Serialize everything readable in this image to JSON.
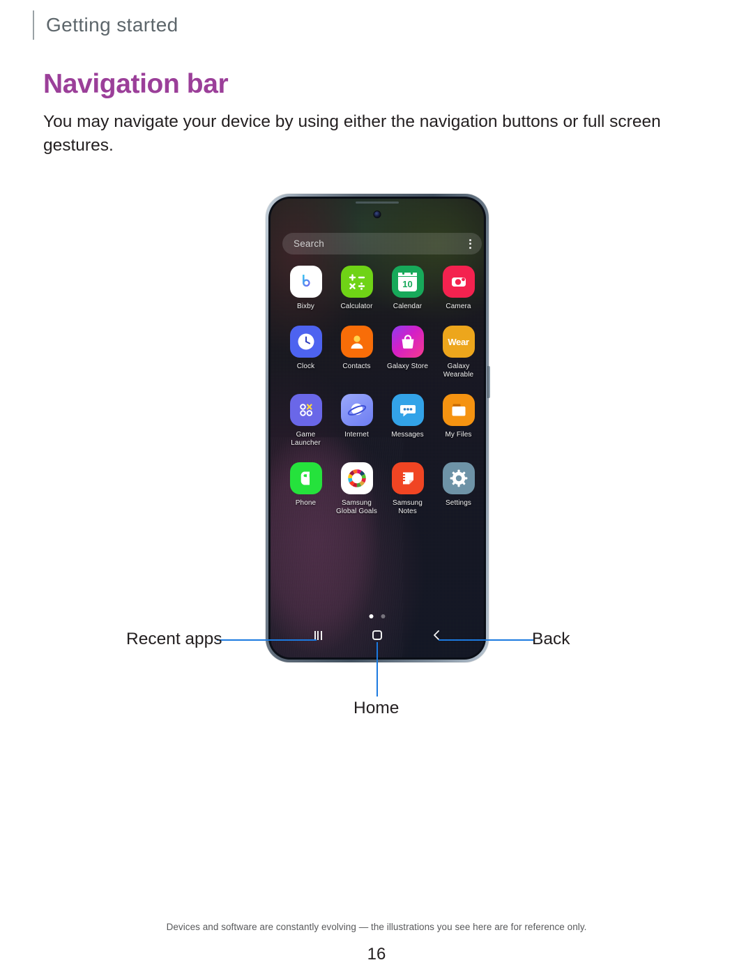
{
  "running_header": {
    "title": "Getting started"
  },
  "section": {
    "title": "Navigation bar",
    "body": "You may navigate your device by using either the navigation buttons or full screen gestures."
  },
  "phone": {
    "search": {
      "placeholder": "Search",
      "more_icon": "kebab-menu-icon"
    },
    "apps": [
      {
        "name": "Bixby",
        "icon": "bixby-icon",
        "bg": "#ffffff"
      },
      {
        "name": "Calculator",
        "icon": "calculator-icon",
        "bg": "#6fd316"
      },
      {
        "name": "Calendar",
        "icon": "calendar-icon",
        "bg": "#17a95a"
      },
      {
        "name": "Camera",
        "icon": "camera-icon",
        "bg": "#f4224f"
      },
      {
        "name": "Clock",
        "icon": "clock-icon",
        "bg": "#4d63f0"
      },
      {
        "name": "Contacts",
        "icon": "contacts-icon",
        "bg": "#f86d08"
      },
      {
        "name": "Galaxy Store",
        "icon": "galaxy-store-icon",
        "bg": "#cf1ec4"
      },
      {
        "name": "Galaxy Wearable",
        "icon": "galaxy-wearable-icon",
        "bg": "#eda61c"
      },
      {
        "name": "Game Launcher",
        "icon": "game-launcher-icon",
        "bg": "#6a67e8"
      },
      {
        "name": "Internet",
        "icon": "internet-icon",
        "bg": "#7b8ef5"
      },
      {
        "name": "Messages",
        "icon": "messages-icon",
        "bg": "#33a3e8"
      },
      {
        "name": "My Files",
        "icon": "my-files-icon",
        "bg": "#f59311"
      },
      {
        "name": "Phone",
        "icon": "phone-icon",
        "bg": "#25e23c"
      },
      {
        "name": "Samsung Global Goals",
        "icon": "global-goals-icon",
        "bg": "#ffffff"
      },
      {
        "name": "Samsung Notes",
        "icon": "samsung-notes-icon",
        "bg": "#f04523"
      },
      {
        "name": "Settings",
        "icon": "settings-icon",
        "bg": "#6e93a7"
      }
    ],
    "calendar_day": "10",
    "wearable_text": "Wear",
    "page_dots": {
      "count": 2,
      "active_index": 0
    },
    "nav_buttons": [
      {
        "name": "Recent apps",
        "icon": "recent-apps-icon"
      },
      {
        "name": "Home",
        "icon": "home-icon"
      },
      {
        "name": "Back",
        "icon": "back-chevron-icon"
      }
    ]
  },
  "callouts": {
    "recent_apps": "Recent apps",
    "home": "Home",
    "back": "Back"
  },
  "footer": {
    "note": "Devices and software are constantly evolving — the illustrations you see here are for reference only.",
    "page_number": "16"
  },
  "colors": {
    "accent_heading": "#9b3f99",
    "leader_line": "#1c7ae0",
    "header_text": "#5d666b",
    "body_text": "#231f20"
  }
}
